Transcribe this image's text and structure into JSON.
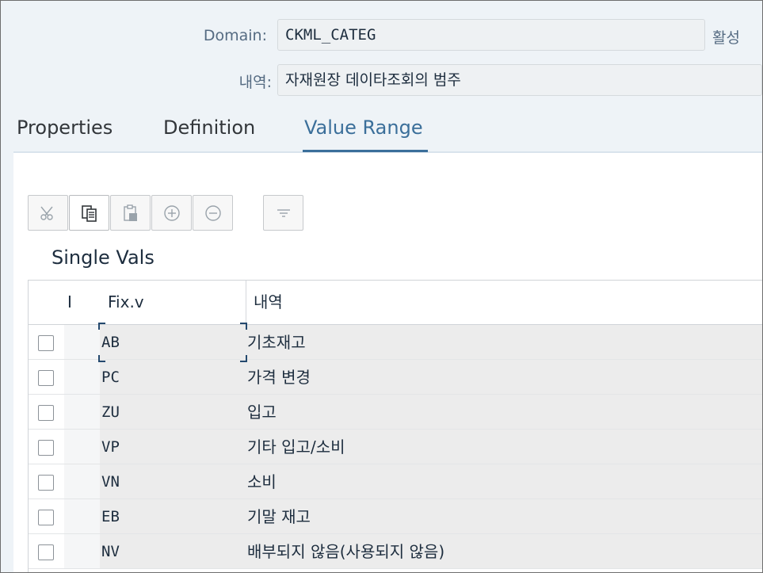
{
  "header": {
    "domain_label": "Domain:",
    "domain_value": "CKML_CATEG",
    "status": "활성",
    "desc_label": "내역:",
    "desc_value": "자재원장 데이타조회의 범주"
  },
  "tabs": [
    {
      "label": "Properties",
      "active": false
    },
    {
      "label": "Definition",
      "active": false
    },
    {
      "label": "Value Range",
      "active": true
    }
  ],
  "toolbar": {
    "icons": [
      "scissors-icon",
      "copy-icon",
      "paste-icon",
      "plus-circle-icon",
      "minus-circle-icon",
      "filter-lines-icon"
    ]
  },
  "section_title": "Single Vals",
  "table": {
    "columns": [
      "",
      "I",
      "Fix.v",
      "내역"
    ],
    "rows": [
      {
        "fixv": "AB",
        "desc": "기초재고"
      },
      {
        "fixv": "PC",
        "desc": "가격 변경"
      },
      {
        "fixv": "ZU",
        "desc": "입고"
      },
      {
        "fixv": "VP",
        "desc": "기타 입고/소비"
      },
      {
        "fixv": "VN",
        "desc": "소비"
      },
      {
        "fixv": "EB",
        "desc": "기말 재고"
      },
      {
        "fixv": "NV",
        "desc": "배부되지 않음(사용되지 않음)"
      }
    ]
  },
  "colors": {
    "accent": "#3b6f9a",
    "header_bg": "#eef3f7",
    "cell_bg": "#ececec"
  }
}
